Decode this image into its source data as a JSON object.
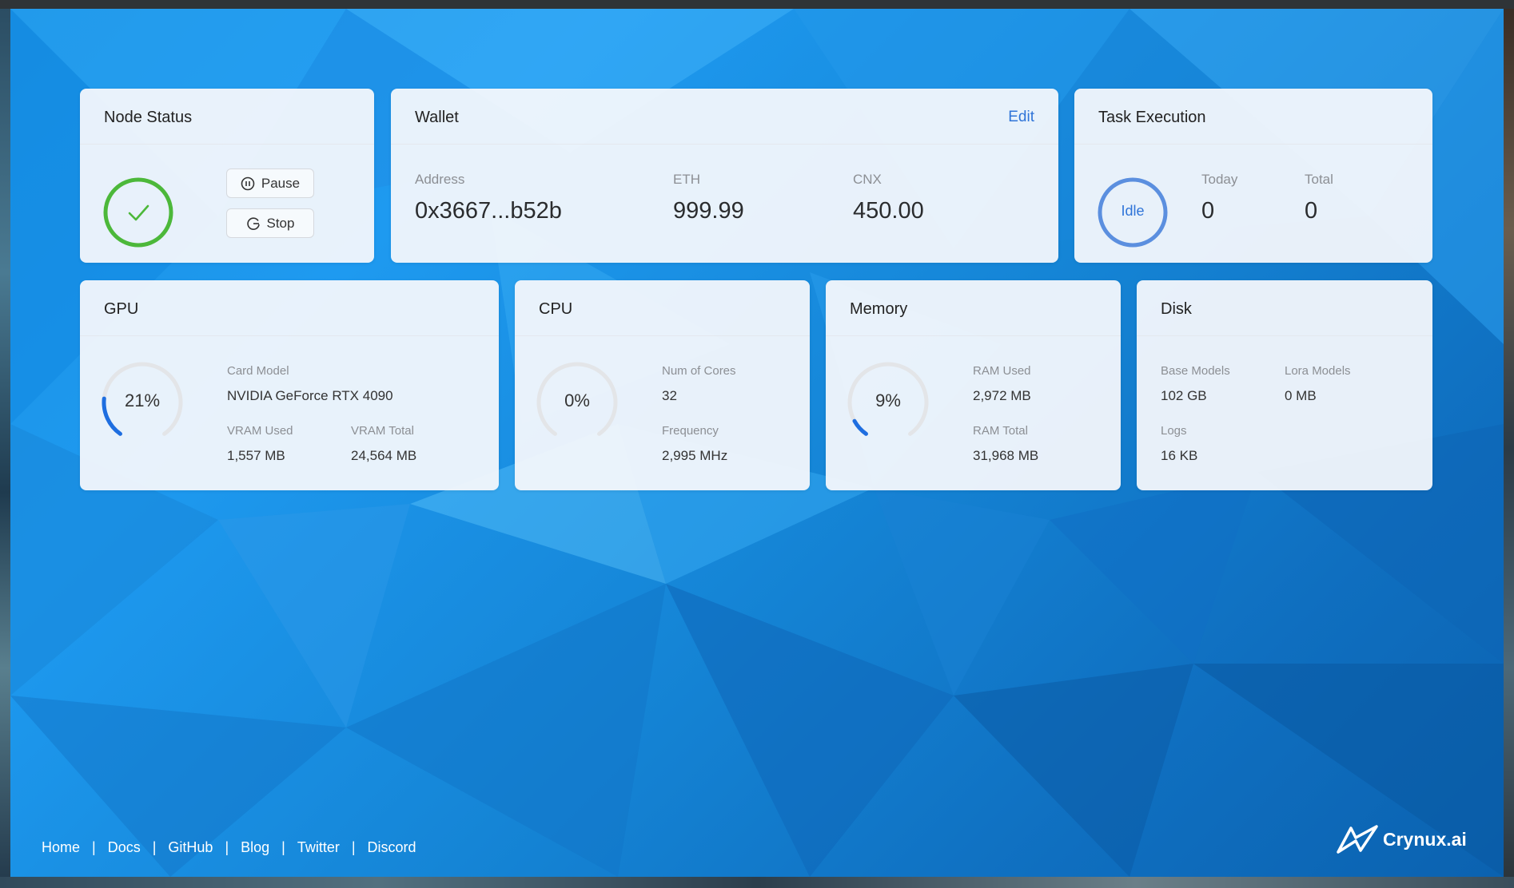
{
  "node_status": {
    "title": "Node Status",
    "pause_label": "Pause",
    "stop_label": "Stop"
  },
  "wallet": {
    "title": "Wallet",
    "edit_label": "Edit",
    "address_label": "Address",
    "address_value": "0x3667...b52b",
    "eth_label": "ETH",
    "eth_value": "999.99",
    "cnx_label": "CNX",
    "cnx_value": "450.00"
  },
  "task": {
    "title": "Task Execution",
    "state": "Idle",
    "today_label": "Today",
    "today_value": "0",
    "total_label": "Total",
    "total_value": "0"
  },
  "gpu": {
    "title": "GPU",
    "usage_text": "21%",
    "usage_fraction": 0.21,
    "model_label": "Card Model",
    "model_value": "NVIDIA GeForce RTX 4090",
    "vram_used_label": "VRAM Used",
    "vram_used_value": "1,557 MB",
    "vram_total_label": "VRAM Total",
    "vram_total_value": "24,564 MB"
  },
  "cpu": {
    "title": "CPU",
    "usage_text": "0%",
    "usage_fraction": 0,
    "cores_label": "Num of Cores",
    "cores_value": "32",
    "freq_label": "Frequency",
    "freq_value": "2,995 MHz"
  },
  "memory": {
    "title": "Memory",
    "usage_text": "9%",
    "usage_fraction": 0.09,
    "ram_used_label": "RAM Used",
    "ram_used_value": "2,972 MB",
    "ram_total_label": "RAM Total",
    "ram_total_value": "31,968 MB"
  },
  "disk": {
    "title": "Disk",
    "base_label": "Base Models",
    "base_value": "102 GB",
    "lora_label": "Lora Models",
    "lora_value": "0 MB",
    "logs_label": "Logs",
    "logs_value": "16 KB"
  },
  "footer": {
    "links": [
      "Home",
      "Docs",
      "GitHub",
      "Blog",
      "Twitter",
      "Discord"
    ]
  },
  "brand": {
    "name": "Crynux.ai"
  },
  "colors": {
    "accent": "#2f74d8",
    "success": "#4cb83a",
    "gauge_track": "#e3e5e8",
    "gauge_fill": "#1e6ee0"
  }
}
